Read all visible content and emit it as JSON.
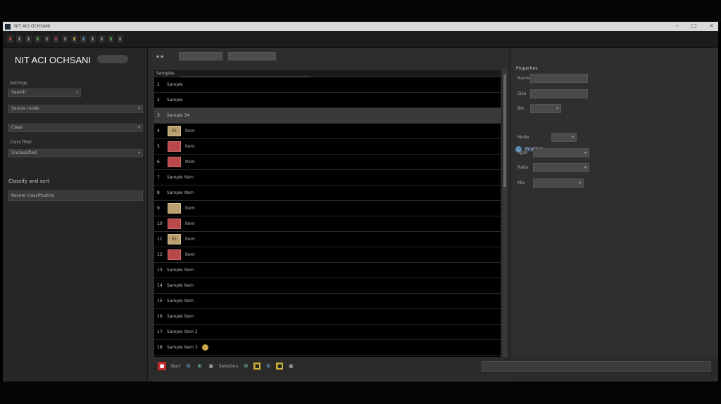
{
  "window": {
    "title": "NIT ACI OCHSANI",
    "controls": [
      "–",
      "□",
      "×"
    ]
  },
  "toolbar": {
    "buttons": [
      {
        "label": "▮",
        "tone": "red"
      },
      {
        "label": "▮",
        "tone": ""
      },
      {
        "label": "▮",
        "tone": ""
      },
      {
        "label": "▮",
        "tone": "grn"
      },
      {
        "label": "▮",
        "tone": ""
      },
      {
        "label": "▮",
        "tone": "red"
      },
      {
        "label": "▮",
        "tone": ""
      },
      {
        "label": "▮",
        "tone": "yel"
      },
      {
        "label": "▮",
        "tone": "blu"
      },
      {
        "label": "▮",
        "tone": ""
      },
      {
        "label": "▮",
        "tone": ""
      },
      {
        "label": "▮",
        "tone": "grn"
      },
      {
        "label": "▮",
        "tone": ""
      }
    ]
  },
  "sidebar": {
    "app_name": "NIT ACI OCHSANI",
    "section_label": "Settings",
    "field1": "Search",
    "field2": "Source mode",
    "field3": "Class",
    "label_options": "Class filter",
    "field4": "Unclassified",
    "note": "Classify and sort",
    "field5": "Recent classification"
  },
  "center": {
    "chip1": "",
    "chip2": "",
    "header": "Samples",
    "rows": [
      {
        "num": "1",
        "name": "Sample",
        "thumb": "",
        "label": "",
        "selected": false
      },
      {
        "num": "2",
        "name": "Sample",
        "thumb": "",
        "label": "",
        "selected": false
      },
      {
        "num": "3",
        "name": "Sample 34",
        "thumb": "",
        "label": "",
        "selected": true
      },
      {
        "num": "4",
        "name": "Item",
        "thumb": "tan",
        "label": "01",
        "selected": false
      },
      {
        "num": "5",
        "name": "Item",
        "thumb": "red",
        "label": "",
        "selected": false
      },
      {
        "num": "6",
        "name": "Item",
        "thumb": "red",
        "label": "",
        "selected": false
      },
      {
        "num": "7",
        "name": "Sample item",
        "thumb": "",
        "label": "",
        "selected": false
      },
      {
        "num": "8",
        "name": "Sample item",
        "thumb": "",
        "label": "",
        "selected": false
      },
      {
        "num": "9",
        "name": "Item",
        "thumb": "tan",
        "label": "",
        "selected": false
      },
      {
        "num": "10",
        "name": "Item",
        "thumb": "red",
        "label": "",
        "selected": false
      },
      {
        "num": "11",
        "name": "Item",
        "thumb": "tan",
        "label": "01",
        "selected": false
      },
      {
        "num": "12",
        "name": "Item",
        "thumb": "red",
        "label": "",
        "selected": false
      },
      {
        "num": "13",
        "name": "Sample item",
        "thumb": "",
        "label": "",
        "selected": false
      },
      {
        "num": "14",
        "name": "Sample item",
        "thumb": "",
        "label": "",
        "selected": false
      },
      {
        "num": "15",
        "name": "Sample item",
        "thumb": "",
        "label": "",
        "selected": false
      },
      {
        "num": "16",
        "name": "Sample item",
        "thumb": "",
        "label": "",
        "selected": false
      },
      {
        "num": "17",
        "name": "Sample item 2",
        "thumb": "",
        "label": "",
        "selected": false
      },
      {
        "num": "18",
        "name": "Sample item 3",
        "thumb": "",
        "label": "",
        "selected": false,
        "badge": true
      }
    ]
  },
  "right_panel": {
    "title": "Properties",
    "rows": [
      {
        "label": "Name",
        "value": "",
        "chev": false
      },
      {
        "label": "Size",
        "value": "",
        "chev": false
      },
      {
        "label": "Bin",
        "value": "",
        "chev": true
      },
      {
        "label": "Mode",
        "value": "",
        "chev": true
      },
      {
        "label": "Type",
        "value": "",
        "chev": true
      },
      {
        "label": "Ratio",
        "value": "",
        "chev": true
      },
      {
        "label": "Mix",
        "value": "",
        "chev": true
      }
    ],
    "toggle": "Enabled"
  },
  "bottom": {
    "items": [
      {
        "label": "Start",
        "icon": "red"
      },
      {
        "label": "",
        "icon": "blue"
      },
      {
        "label": "",
        "icon": "grn"
      },
      {
        "label": "Selection",
        "icon": ""
      },
      {
        "label": "",
        "icon": "grn"
      },
      {
        "label": "",
        "icon": "yel"
      },
      {
        "label": "",
        "icon": "blue"
      },
      {
        "label": "",
        "icon": "yel"
      },
      {
        "label": "",
        "icon": ""
      }
    ]
  }
}
